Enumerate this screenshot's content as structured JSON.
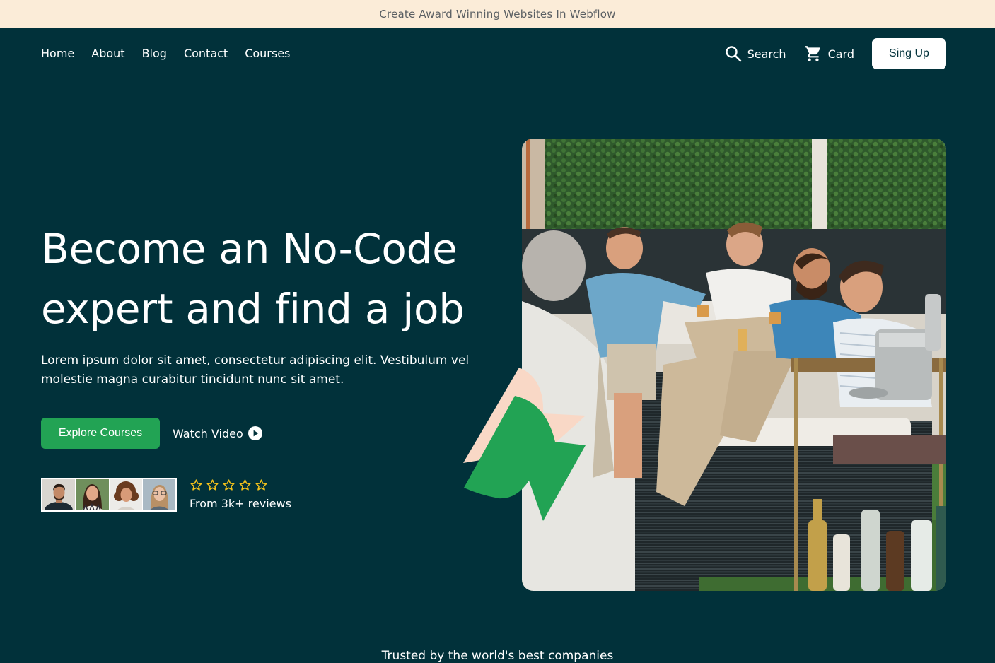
{
  "announcement": {
    "text": "Create Award Winning Websites In Webflow"
  },
  "nav": {
    "links": [
      "Home",
      "About",
      "Blog",
      "Contact",
      "Courses"
    ],
    "search_label": "Search",
    "search_icon": "search-icon",
    "cart_label": "Card",
    "cart_icon": "cart-icon",
    "signup_label": "Sing Up"
  },
  "hero": {
    "title_line1": "Become an No-Code",
    "title_line2": "expert and find a job",
    "description": "Lorem ipsum dolor sit amet, consectetur adipiscing elit. Vestibulum vel molestie magna curabitur tincidunt nunc sit amet.",
    "explore_label": "Explore Courses",
    "watch_label": "Watch Video",
    "watch_icon": "play-circle-icon"
  },
  "reviews": {
    "star_count": 5,
    "star_icon": "star-outline-icon",
    "text": "From 3k+ reviews"
  },
  "trusted": {
    "text": "Trusted by the world's best companies"
  },
  "colors": {
    "background": "#01313a",
    "announcement_bg": "#fbecd8",
    "accent_green": "#22a354",
    "star_yellow": "#f4c21b",
    "deco_peach": "#f9d8c6"
  }
}
